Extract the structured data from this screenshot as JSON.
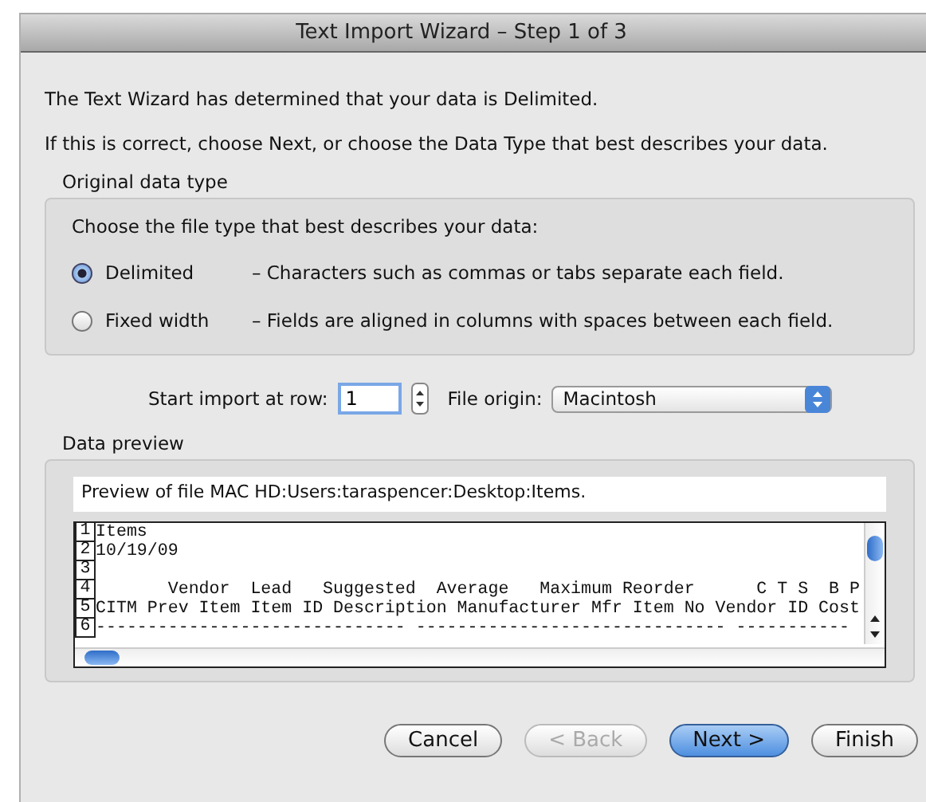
{
  "window": {
    "title": "Text Import Wizard – Step 1 of 3"
  },
  "intro": [
    "The Text Wizard has determined that your data is Delimited.",
    "If this is correct, choose Next, or choose the Data Type that best describes your data."
  ],
  "original_data_type": {
    "title": "Original data type",
    "prompt": "Choose the file type that best describes your data:",
    "options": [
      {
        "label": "Delimited",
        "description": "– Characters such as commas or tabs separate each field.",
        "selected": true
      },
      {
        "label": "Fixed width",
        "description": "– Fields are aligned in columns with spaces between each field.",
        "selected": false
      }
    ]
  },
  "start_row": {
    "label": "Start import at row:",
    "value": "1"
  },
  "file_origin": {
    "label": "File origin:",
    "value": "Macintosh"
  },
  "data_preview": {
    "title": "Data preview",
    "caption": "Preview of file MAC HD:Users:taraspencer:Desktop:Items.",
    "rows": [
      {
        "number": "1",
        "text": "Items"
      },
      {
        "number": "2",
        "text": "10/19/09"
      },
      {
        "number": "3",
        "text": ""
      },
      {
        "number": "4",
        "text": "       Vendor  Lead   Suggested  Average   Maximum Reorder      C T S  B P"
      },
      {
        "number": "5",
        "text": "CITM Prev Item Item ID Description Manufacturer Mfr Item No Vendor ID Cost"
      },
      {
        "number": "6",
        "text": "------------------------------ ------------------------------ -----------"
      }
    ]
  },
  "buttons": [
    {
      "label": "Cancel",
      "kind": "normal",
      "disabled": false
    },
    {
      "label": "< Back",
      "kind": "normal",
      "disabled": true
    },
    {
      "label": "Next >",
      "kind": "default",
      "disabled": false
    },
    {
      "label": "Finish",
      "kind": "normal",
      "disabled": false
    }
  ]
}
